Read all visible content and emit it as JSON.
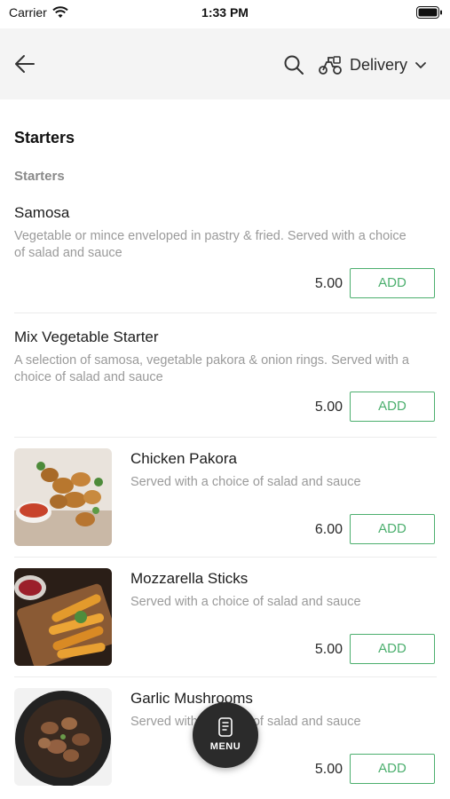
{
  "status_bar": {
    "carrier": "Carrier",
    "time": "1:33 PM"
  },
  "header": {
    "delivery_label": "Delivery"
  },
  "section": {
    "title": "Starters",
    "subtitle": "Starters"
  },
  "items": [
    {
      "name": "Samosa",
      "desc_line1": "Vegetable or mince enveloped in pastry & fried. Served with a choice",
      "desc_line2": "of salad and sauce",
      "price": "5.00",
      "add_label": "ADD"
    },
    {
      "name": "Mix Vegetable Starter",
      "desc_line1": "A selection of samosa, vegetable pakora & onion rings. Served with a",
      "desc_line2": "choice of salad and sauce",
      "price": "5.00",
      "add_label": "ADD"
    },
    {
      "name": "Chicken Pakora",
      "desc": "Served with a choice of salad and sauce",
      "price": "6.00",
      "add_label": "ADD"
    },
    {
      "name": "Mozzarella Sticks",
      "desc": "Served with a choice of salad and sauce",
      "price": "5.00",
      "add_label": "ADD"
    },
    {
      "name": "Garlic Mushrooms",
      "desc": "Served with a choice of salad and sauce",
      "price": "5.00",
      "add_label": "ADD"
    }
  ],
  "menu_button": {
    "label": "MENU"
  },
  "colors": {
    "accent_green": "#4caf6e",
    "header_bg": "#f4f4f4",
    "fab_bg": "#2b2b2b"
  }
}
